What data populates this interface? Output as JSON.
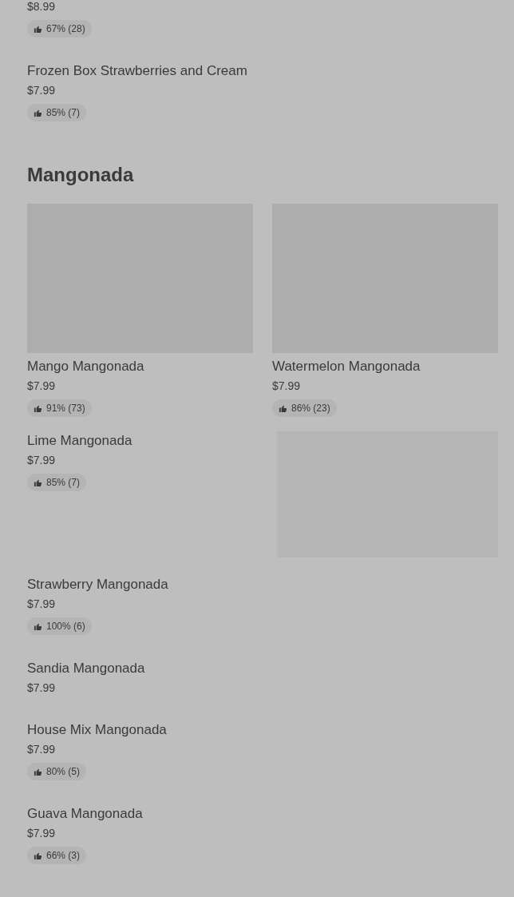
{
  "sections": [
    {
      "items": [
        {
          "kind": "plain",
          "price": "$8.99",
          "rating": "67% (28)"
        },
        {
          "kind": "plain",
          "name": "Frozen Box Strawberries and Cream",
          "price": "$7.99",
          "rating": "85% (7)"
        }
      ]
    },
    {
      "title": "Mangonada",
      "items": [
        {
          "kind": "tile",
          "name": "Mango Mangonada",
          "price": "$7.99",
          "rating": "91% (73)"
        },
        {
          "kind": "tile",
          "name": "Watermelon Mangonada",
          "price": "$7.99",
          "rating": "86% (23)"
        },
        {
          "kind": "side",
          "name": "Lime Mangonada",
          "price": "$7.99",
          "rating": "85% (7)"
        },
        {
          "kind": "plain",
          "name": "Strawberry Mangonada",
          "price": "$7.99",
          "rating": "100% (6)"
        },
        {
          "kind": "plain",
          "name": "Sandia Mangonada",
          "price": "$7.99"
        },
        {
          "kind": "plain",
          "name": "House Mix Mangonada",
          "price": "$7.99",
          "rating": "80% (5)"
        },
        {
          "kind": "plain",
          "name": "Guava Mangonada",
          "price": "$7.99",
          "rating": "66% (3)"
        }
      ]
    }
  ]
}
